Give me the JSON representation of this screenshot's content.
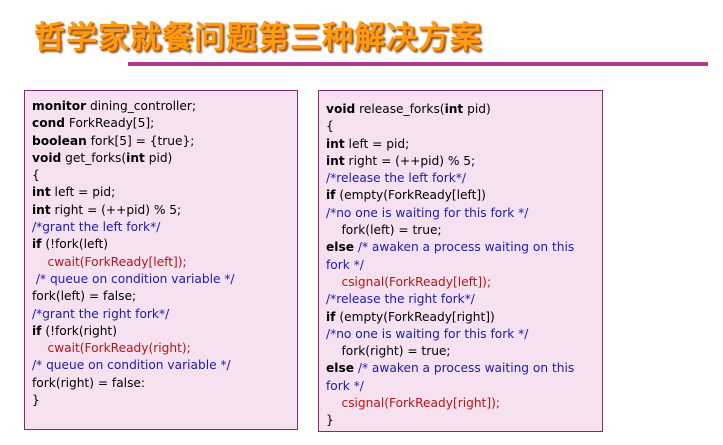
{
  "title": "哲学家就餐问题第三种解决方案",
  "colors": {
    "title": "#ff9a14",
    "accent_rule": "#b23a8e",
    "panel_bg": "#f6e1f1",
    "panel_border": "#8a2a6e",
    "code": "#000000",
    "comment": "#1c1ca8",
    "call": "#b31616"
  },
  "left_code": [
    [
      {
        "t": "monitor",
        "b": true
      },
      {
        "t": " dining_controller;"
      }
    ],
    [
      {
        "t": "cond",
        "b": true
      },
      {
        "t": " ForkReady[5];"
      }
    ],
    [
      {
        "t": "boolean",
        "b": true
      },
      {
        "t": " fork[5] = {true};"
      }
    ],
    [
      {
        "t": "void",
        "b": true
      },
      {
        "t": " get_forks("
      },
      {
        "t": "int",
        "b": true
      },
      {
        "t": " pid)"
      }
    ],
    [
      {
        "t": "{"
      }
    ],
    [
      {
        "t": "int",
        "b": true
      },
      {
        "t": " left = pid;"
      }
    ],
    [
      {
        "t": "int",
        "b": true
      },
      {
        "t": " right = (++pid) % 5;"
      }
    ],
    [
      {
        "t": "/*grant the left fork*/",
        "c": 1
      }
    ],
    [
      {
        "t": "if",
        "b": true
      },
      {
        "t": " (!fork(left)"
      }
    ],
    [
      {
        "t": "    cwait(ForkReady[left]);",
        "c": 2
      }
    ],
    [
      {
        "t": " /* queue on condition variable */",
        "c": 1
      }
    ],
    [
      {
        "t": "fork(left) = false;"
      }
    ],
    [
      {
        "t": "/*grant the right fork*/",
        "c": 1
      }
    ],
    [
      {
        "t": "if",
        "b": true
      },
      {
        "t": " (!fork(right)"
      }
    ],
    [
      {
        "t": "    cwait(ForkReady(right);",
        "c": 2
      }
    ],
    [
      {
        "t": "/* queue on condition variable */",
        "c": 1
      }
    ],
    [
      {
        "t": "fork(right) = false:"
      }
    ],
    [
      {
        "t": "}"
      }
    ]
  ],
  "right_code": [
    [
      {
        "t": "void",
        "b": true
      },
      {
        "t": " release_forks("
      },
      {
        "t": "int",
        "b": true
      },
      {
        "t": " pid)"
      }
    ],
    [
      {
        "t": "{"
      }
    ],
    [
      {
        "t": "int",
        "b": true
      },
      {
        "t": " left = pid;"
      }
    ],
    [
      {
        "t": "int",
        "b": true
      },
      {
        "t": " right = (++pid) % 5;"
      }
    ],
    [
      {
        "t": "/*release the left fork*/",
        "c": 1
      }
    ],
    [
      {
        "t": "if",
        "b": true
      },
      {
        "t": " (empty(ForkReady[left])"
      }
    ],
    [
      {
        "t": "/*no one is waiting for this fork */",
        "c": 1
      }
    ],
    [
      {
        "t": "    fork(left) = true;"
      }
    ],
    [
      {
        "t": "else",
        "b": true
      },
      {
        "t": " /* awaken a process waiting on this fork */",
        "c": 1,
        "w": true
      }
    ],
    [
      {
        "t": "    csignal(ForkReady[left]);",
        "c": 2
      }
    ],
    [
      {
        "t": "/*release the right fork*/",
        "c": 1
      }
    ],
    [
      {
        "t": "if",
        "b": true
      },
      {
        "t": " (empty(ForkReady[right])"
      }
    ],
    [
      {
        "t": "/*no one is waiting for this fork */",
        "c": 1
      }
    ],
    [
      {
        "t": "    fork(right) = true;"
      }
    ],
    [
      {
        "t": "else",
        "b": true
      },
      {
        "t": " /* awaken a process waiting on this fork */",
        "c": 1,
        "w": true
      }
    ],
    [
      {
        "t": "    csignal(ForkReady[right]);",
        "c": 2
      }
    ],
    [
      {
        "t": "}"
      }
    ]
  ]
}
